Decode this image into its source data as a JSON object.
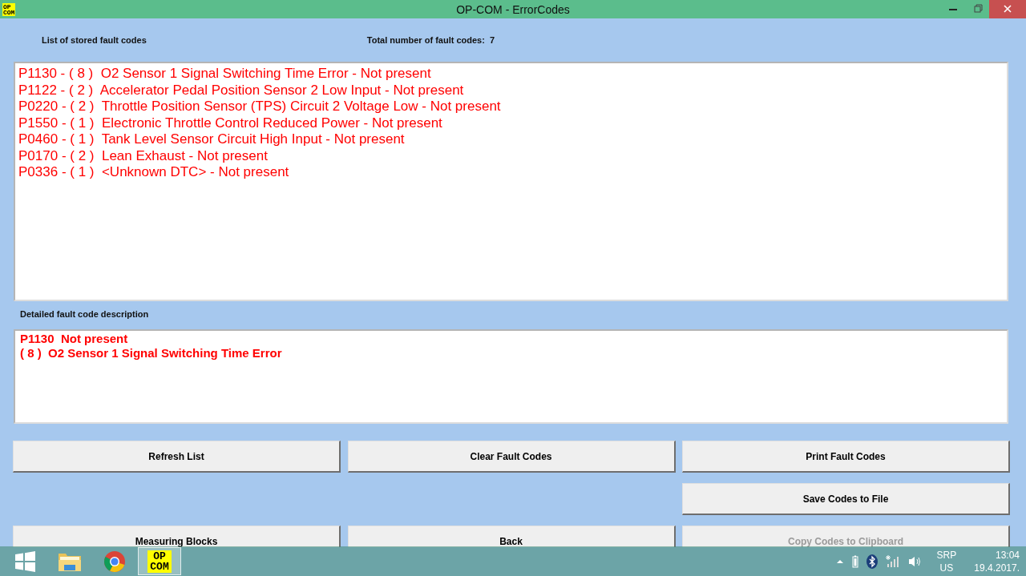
{
  "window": {
    "title": "OP-COM - ErrorCodes",
    "app_logo": "OP\nCOM"
  },
  "list_label": "List of stored fault codes",
  "total": {
    "label": "Total number of fault codes:",
    "count": "7"
  },
  "fault_codes": [
    {
      "text": "P1130 - ( 8 )  O2 Sensor 1 Signal Switching Time Error - Not present"
    },
    {
      "text": "P1122 - ( 2 )  Accelerator Pedal Position Sensor 2 Low Input - Not present"
    },
    {
      "text": "P0220 - ( 2 )  Throttle Position Sensor (TPS) Circuit 2 Voltage Low - Not present"
    },
    {
      "text": "P1550 - ( 1 )  Electronic Throttle Control Reduced Power - Not present"
    },
    {
      "text": "P0460 - ( 1 )  Tank Level Sensor Circuit High Input - Not present"
    },
    {
      "text": "P0170 - ( 2 )  Lean Exhaust - Not present"
    },
    {
      "text": "P0336 - ( 1 )  <Unknown DTC> - Not present"
    }
  ],
  "detail_label": "Detailed fault code description",
  "detail_lines": [
    "P1130  Not present",
    "( 8 )  O2 Sensor 1 Signal Switching Time Error"
  ],
  "buttons": [
    {
      "label": "Refresh List",
      "disabled": false,
      "kind": "normal"
    },
    {
      "label": "Clear Fault Codes",
      "disabled": false,
      "kind": "normal"
    },
    {
      "label": "Print Fault Codes",
      "disabled": false,
      "kind": "normal"
    },
    {
      "kind": "spacer"
    },
    {
      "kind": "spacer"
    },
    {
      "label": "Save Codes to File",
      "disabled": false,
      "kind": "normal"
    },
    {
      "label": "Measuring Blocks",
      "disabled": false,
      "kind": "normal"
    },
    {
      "label": "Back",
      "disabled": false,
      "kind": "normal"
    },
    {
      "label": "Copy Codes to Clipboard",
      "disabled": true,
      "kind": "normal"
    }
  ],
  "taskbar": {
    "apps": [
      {
        "kind": "start",
        "selected": false
      },
      {
        "kind": "folder",
        "selected": false
      },
      {
        "kind": "browser",
        "selected": false
      },
      {
        "kind": "opcom",
        "selected": true,
        "label": "OP\nCOM"
      }
    ],
    "language": "SRP",
    "layout": "US",
    "time": "13:04",
    "date": "19.4.2017."
  }
}
